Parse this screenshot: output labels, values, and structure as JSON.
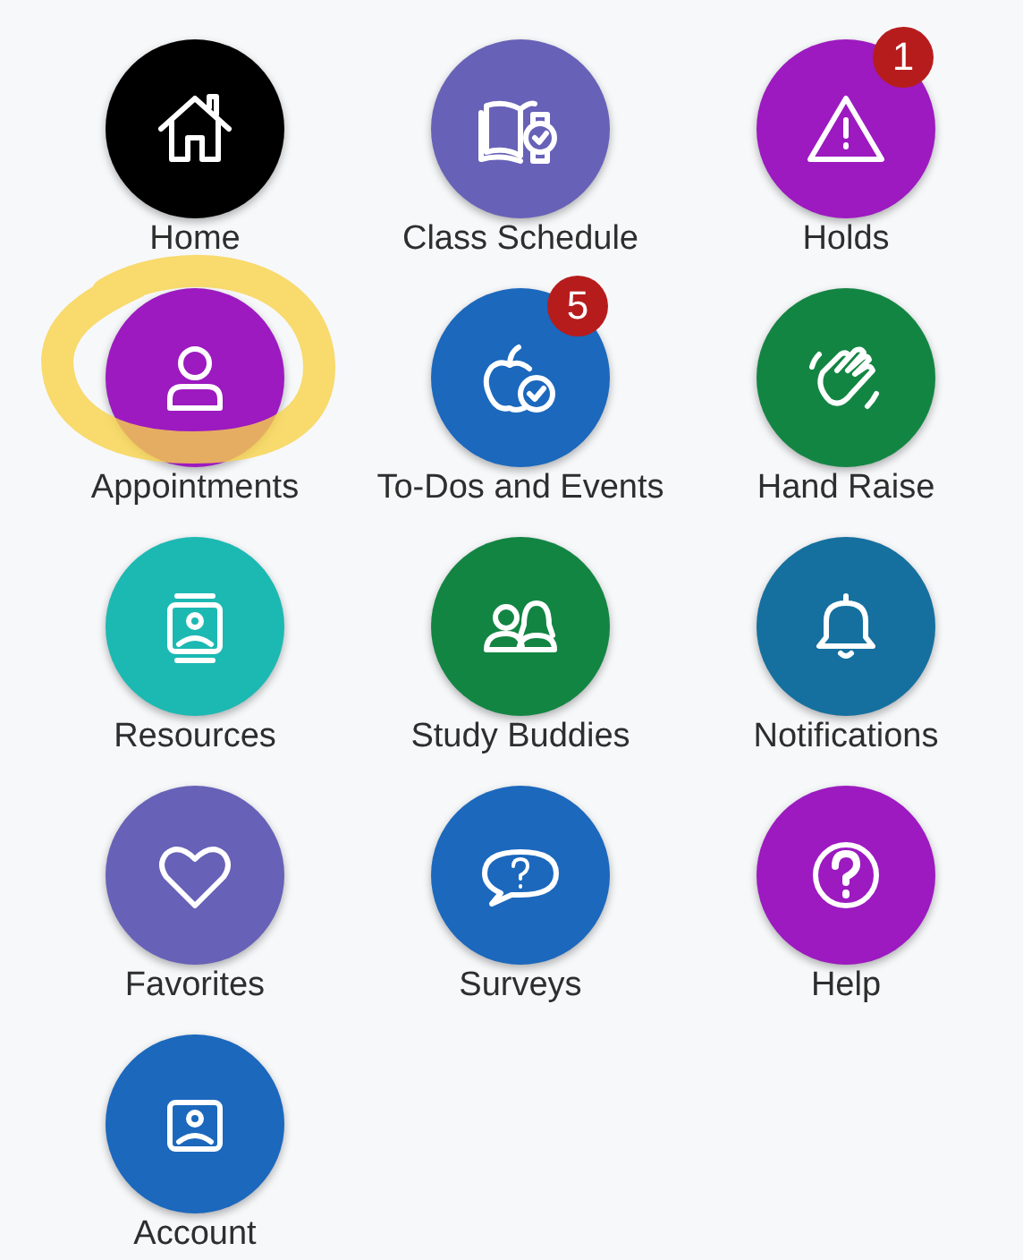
{
  "tiles": [
    {
      "label": "Home",
      "color": "#000000",
      "highlighted": false
    },
    {
      "label": "Class Schedule",
      "color": "#6761b8",
      "highlighted": false
    },
    {
      "label": "Holds",
      "color": "#9c1ac0",
      "badge": "1",
      "highlighted": false
    },
    {
      "label": "Appointments",
      "color": "#9c1ac0",
      "highlighted": true
    },
    {
      "label": "To-Dos and Events",
      "color": "#1b68bd",
      "badge": "5",
      "highlighted": false
    },
    {
      "label": "Hand Raise",
      "color": "#138543",
      "highlighted": false
    },
    {
      "label": "Resources",
      "color": "#1cb9b3",
      "highlighted": false
    },
    {
      "label": "Study Buddies",
      "color": "#138543",
      "highlighted": false
    },
    {
      "label": "Notifications",
      "color": "#15709f",
      "highlighted": false
    },
    {
      "label": "Favorites",
      "color": "#6761b8",
      "highlighted": false
    },
    {
      "label": "Surveys",
      "color": "#1b68bd",
      "highlighted": false
    },
    {
      "label": "Help",
      "color": "#9c1ac0",
      "highlighted": false
    },
    {
      "label": "Account",
      "color": "#1b68bd",
      "highlighted": false
    }
  ]
}
